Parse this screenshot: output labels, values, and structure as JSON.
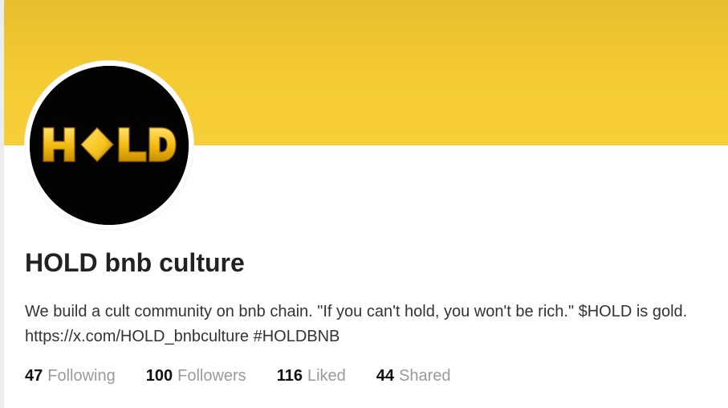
{
  "banner": {
    "color": "#f4cb33"
  },
  "avatar": {
    "logo_text": "HOLD",
    "background_color": "#030303",
    "logo_color": "#f2b90f"
  },
  "profile": {
    "name": "HOLD bnb culture",
    "bio": "We build a cult community on bnb chain. \"If you can't hold, you won't be rich.\" $HOLD is gold. https://x.com/HOLD_bnbculture #HOLDBNB"
  },
  "stats": {
    "following": {
      "value": "47",
      "label": "Following"
    },
    "followers": {
      "value": "100",
      "label": "Followers"
    },
    "liked": {
      "value": "116",
      "label": "Liked"
    },
    "shared": {
      "value": "44",
      "label": "Shared"
    }
  }
}
